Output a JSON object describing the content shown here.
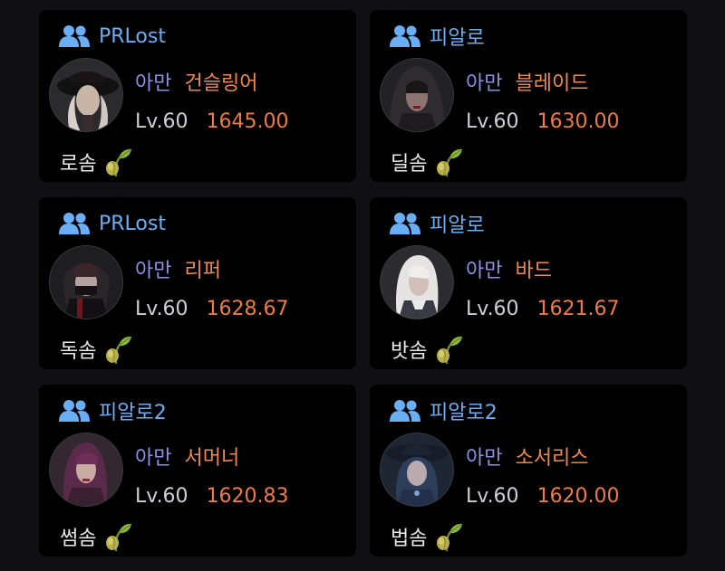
{
  "icons": {
    "guild": "group-icon",
    "role": "sprout-icon"
  },
  "colors": {
    "guild": "#6aaef5",
    "server": "#8e90e6",
    "class": "#ee8a4d",
    "level": "#cfcfd3",
    "item_level": "#ee7a45",
    "card_bg": "#000000",
    "page_bg": "#101014"
  },
  "cards": [
    {
      "guild": "PRLost",
      "server": "아만",
      "class": "건슬링어",
      "level": "Lv.60",
      "item_level": "1645.00",
      "role": "로솜"
    },
    {
      "guild": "피알로",
      "server": "아만",
      "class": "블레이드",
      "level": "Lv.60",
      "item_level": "1630.00",
      "role": "딜솜"
    },
    {
      "guild": "PRLost",
      "server": "아만",
      "class": "리퍼",
      "level": "Lv.60",
      "item_level": "1628.67",
      "role": "독솜"
    },
    {
      "guild": "피알로",
      "server": "아만",
      "class": "바드",
      "level": "Lv.60",
      "item_level": "1621.67",
      "role": "밧솜"
    },
    {
      "guild": "피알로2",
      "server": "아만",
      "class": "서머너",
      "level": "Lv.60",
      "item_level": "1620.83",
      "role": "썸솜"
    },
    {
      "guild": "피알로2",
      "server": "아만",
      "class": "소서리스",
      "level": "Lv.60",
      "item_level": "1620.00",
      "role": "법솜"
    }
  ]
}
